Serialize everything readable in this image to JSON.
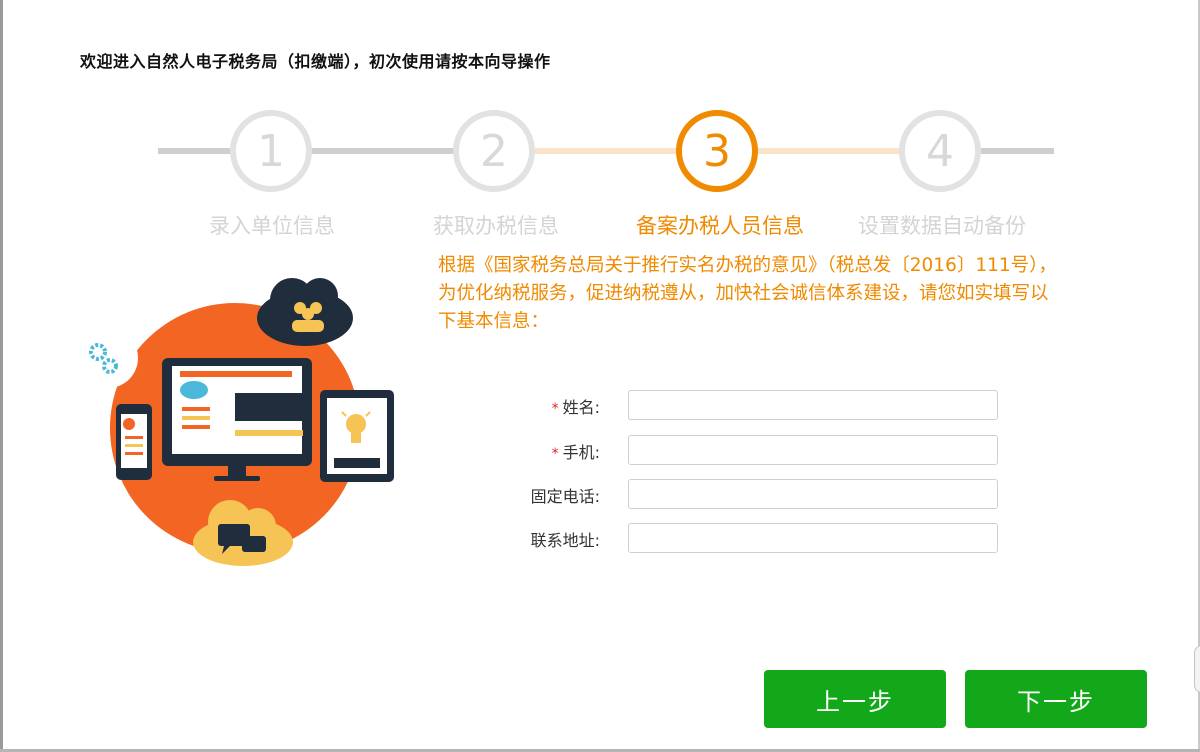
{
  "header": {
    "title": "欢迎进入自然人电子税务局（扣缴端），初次使用请按本向导操作"
  },
  "steps": [
    {
      "number": "1",
      "label": "录入单位信息",
      "state": "inactive"
    },
    {
      "number": "2",
      "label": "获取办税信息",
      "state": "inactive"
    },
    {
      "number": "3",
      "label": "备案办税人员信息",
      "state": "active"
    },
    {
      "number": "4",
      "label": "设置数据自动备份",
      "state": "inactive"
    }
  ],
  "notice": "根据《国家税务总局关于推行实名办税的意见》（税总发〔2016〕111号），为优化纳税服务，促进纳税遵从，加快社会诚信体系建设，请您如实填写以下基本信息：",
  "form": {
    "required_mark": "*",
    "fields": [
      {
        "label": "姓名:",
        "required": true,
        "value": "",
        "placeholder": ""
      },
      {
        "label": "手机:",
        "required": true,
        "value": "",
        "placeholder": ""
      },
      {
        "label": "固定电话:",
        "required": false,
        "value": "",
        "placeholder": ""
      },
      {
        "label": "联系地址:",
        "required": false,
        "value": "",
        "placeholder": ""
      }
    ]
  },
  "buttons": {
    "prev_label": "上一步",
    "next_label": "下一步"
  },
  "colors": {
    "accent": "#f08a00",
    "button_green": "#12a81a",
    "inactive_gray": "#d8d8d8",
    "illustration_orange": "#f26522",
    "illustration_navy": "#1f2d3d"
  },
  "icons": [
    "gear-icon",
    "people-cloud-icon",
    "monitor-icon",
    "phone-icon",
    "tablet-icon",
    "lightbulb-icon",
    "chat-cloud-icon"
  ]
}
